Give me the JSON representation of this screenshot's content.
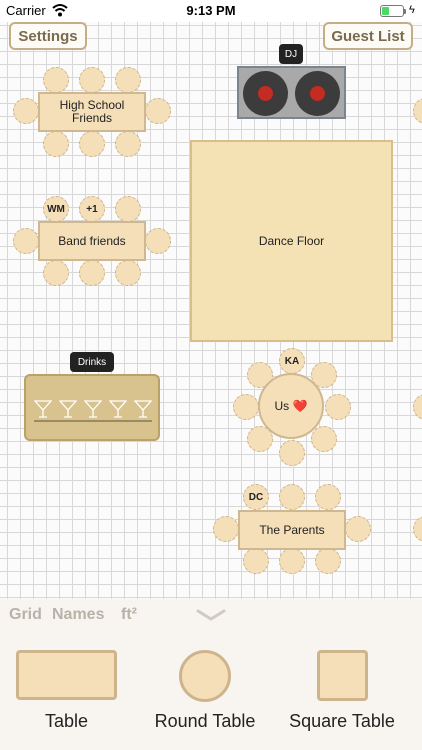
{
  "status_bar": {
    "carrier": "Carrier",
    "time": "9:13 PM"
  },
  "toolbar": {
    "settings": "Settings",
    "guest_list": "Guest List"
  },
  "tables": {
    "high_school": {
      "label": "High School Friends"
    },
    "band": {
      "label": "Band friends",
      "seats": [
        "WM",
        "+1"
      ]
    },
    "us": {
      "label": "Us ❤️",
      "seats": [
        "KA"
      ]
    },
    "parents": {
      "label": "The Parents",
      "seats": [
        "DC"
      ]
    }
  },
  "dance_floor": {
    "label": "Dance Floor"
  },
  "dj": {
    "label": "DJ"
  },
  "drinks": {
    "label": "Drinks"
  },
  "options": {
    "grid": "Grid",
    "names": "Names",
    "area": "ft²"
  },
  "palette": {
    "table": "Table",
    "round_table": "Round Table",
    "square_table": "Square Table"
  },
  "colors": {
    "seat_fill": "#f4dfb9",
    "seat_border": "#cbb48f",
    "dance_floor": "#f4e1b4",
    "bar": "#d8c38f",
    "record_label": "#c22c22"
  }
}
